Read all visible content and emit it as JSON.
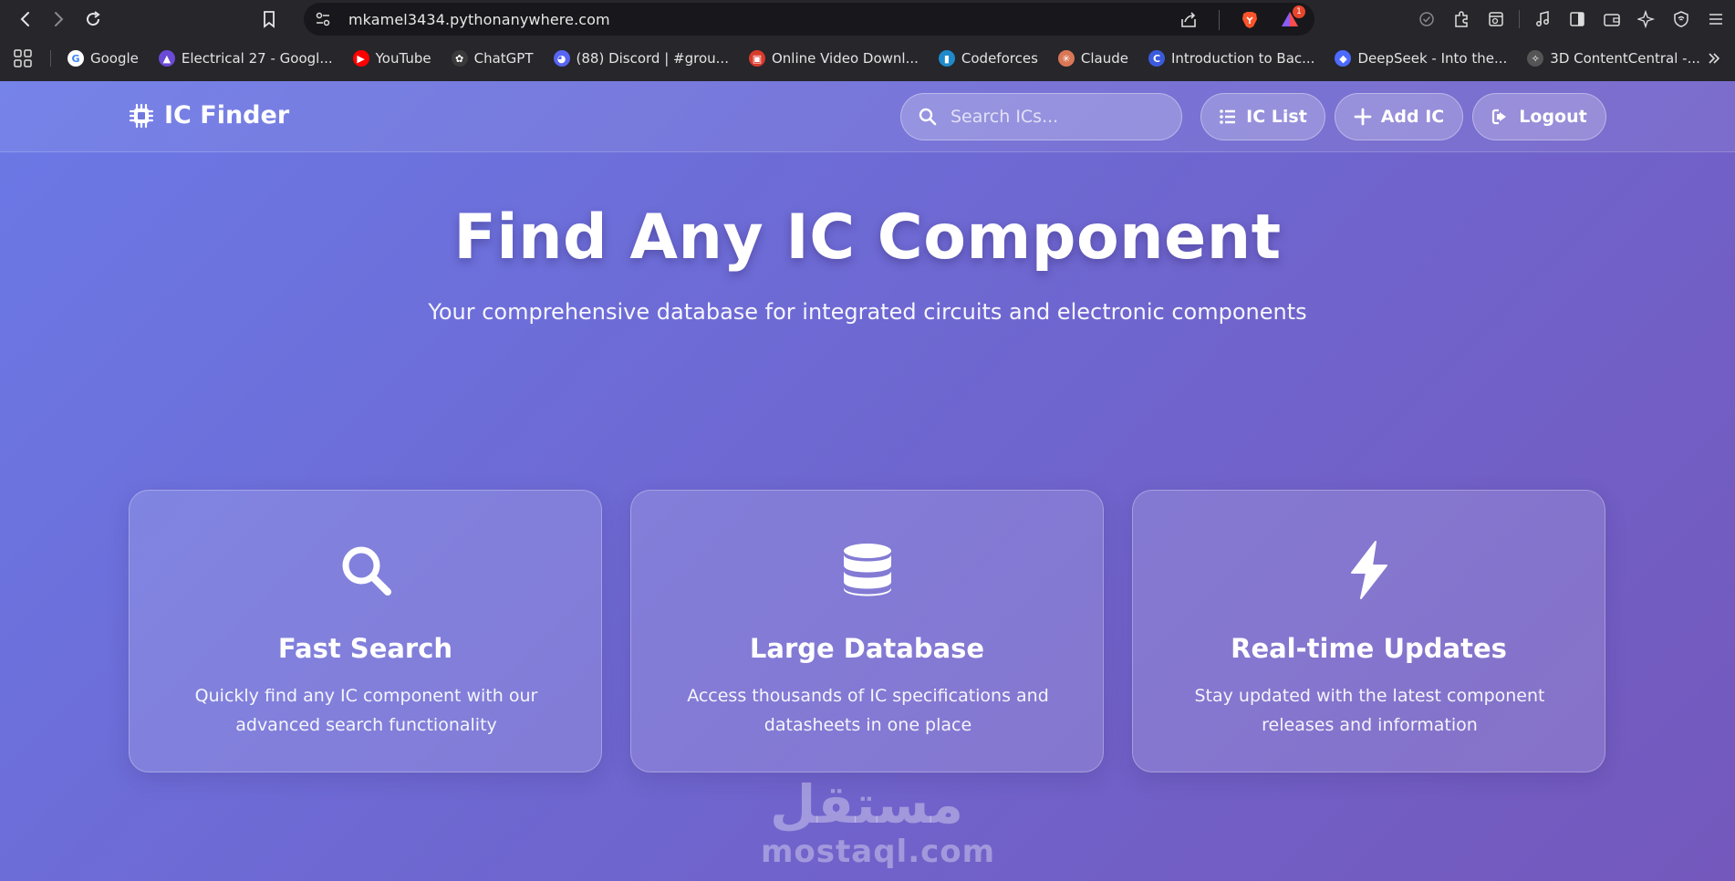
{
  "browser": {
    "url": "mkamel3434.pythonanywhere.com",
    "alert_count": "1",
    "bookmarks": [
      {
        "label": "Google",
        "color": "#ffffff",
        "glyph": "G"
      },
      {
        "label": "Electrical 27 - Googl...",
        "color": "#6b4ad6",
        "glyph": "▲"
      },
      {
        "label": "YouTube",
        "color": "#ff0000",
        "glyph": "▶"
      },
      {
        "label": "ChatGPT",
        "color": "#3a3a3a",
        "glyph": "✿"
      },
      {
        "label": "(88) Discord | #grou...",
        "color": "#5865f2",
        "glyph": "◕"
      },
      {
        "label": "Online Video Downl...",
        "color": "#d83a2c",
        "glyph": "▣"
      },
      {
        "label": "Codeforces",
        "color": "#1f8acb",
        "glyph": "▮"
      },
      {
        "label": "Claude",
        "color": "#d97757",
        "glyph": "✳"
      },
      {
        "label": "Introduction to Bac...",
        "color": "#3b5bdb",
        "glyph": "C"
      },
      {
        "label": "DeepSeek - Into the...",
        "color": "#4d6bfe",
        "glyph": "◆"
      },
      {
        "label": "3D ContentCentral -...",
        "color": "#555555",
        "glyph": "✧"
      }
    ]
  },
  "header": {
    "brand": "IC Finder",
    "search_placeholder": "Search ICs...",
    "buttons": {
      "list": "IC List",
      "add": "Add IC",
      "logout": "Logout"
    }
  },
  "hero": {
    "title": "Find Any IC Component",
    "subtitle": "Your comprehensive database for integrated circuits and electronic components"
  },
  "features": [
    {
      "icon": "search-icon",
      "title": "Fast Search",
      "description": "Quickly find any IC component with our advanced search functionality"
    },
    {
      "icon": "database-icon",
      "title": "Large Database",
      "description": "Access thousands of IC specifications and datasheets in one place"
    },
    {
      "icon": "bolt-icon",
      "title": "Real-time Updates",
      "description": "Stay updated with the latest component releases and information"
    }
  ],
  "watermark": {
    "arabic": "مستقل",
    "latin": "mostaql.com"
  },
  "colors": {
    "gradient_start": "#6b79e6",
    "gradient_end": "#7458bc",
    "chrome_bg": "#26262b"
  }
}
